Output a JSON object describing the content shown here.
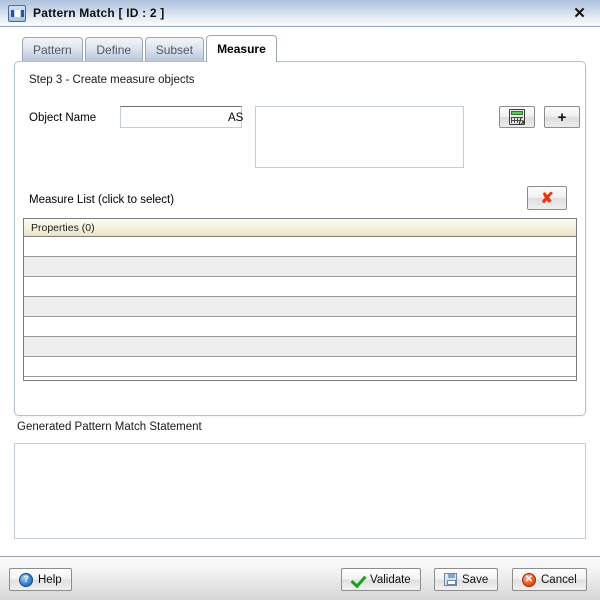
{
  "window": {
    "title": "Pattern Match [ ID : 2 ]",
    "icon": "window-icon",
    "close_label": "✕"
  },
  "tabs": [
    {
      "label": "Pattern",
      "active": false
    },
    {
      "label": "Define",
      "active": false
    },
    {
      "label": "Subset",
      "active": false
    },
    {
      "label": "Measure",
      "active": true
    }
  ],
  "panel": {
    "step_title": "Step 3 - Create measure objects",
    "object_name_label": "Object Name",
    "object_name_value": "",
    "object_name_placeholder": "",
    "as_label": "AS",
    "as_value": "",
    "as_placeholder": "",
    "function_button_label": "",
    "add_button_label": "+",
    "measure_list_label": "Measure List (click to select)",
    "delete_button_label": "✘"
  },
  "table": {
    "header": "Properties (0)",
    "rows": [
      "",
      "",
      "",
      "",
      "",
      "",
      ""
    ]
  },
  "generated": {
    "label": "Generated Pattern Match Statement",
    "value": "",
    "placeholder": ""
  },
  "footer": {
    "help": "Help",
    "validate": "Validate",
    "save": "Save",
    "cancel": "Cancel",
    "help_glyph": "?",
    "cancel_glyph": "✕"
  },
  "colors": {
    "titlebar_top": "#aec1dc",
    "table_header": "#f4f1dd",
    "delete_x": "#e03b14",
    "validate_check": "#1e9e1e",
    "cancel_circle": "#ef5a22",
    "help_circle": "#3a86cf"
  }
}
